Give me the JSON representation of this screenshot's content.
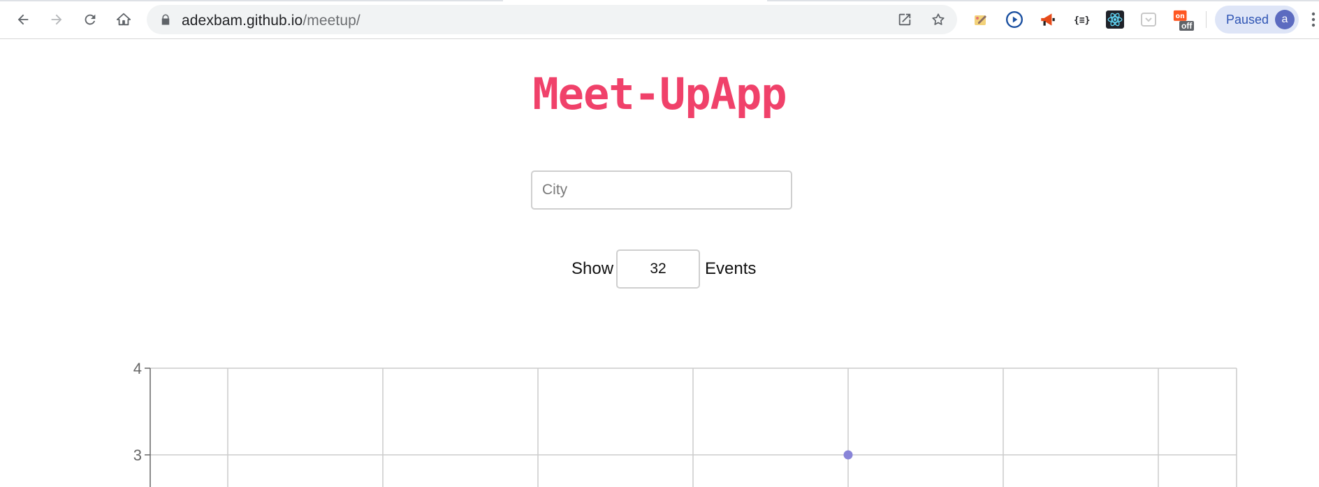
{
  "browser": {
    "url_host": "adexbam.github.io",
    "url_path": "/meetup/",
    "profile_status": "Paused",
    "profile_initial": "a",
    "extensions": [
      "color-picker-icon",
      "play-circle-icon",
      "megaphone-icon",
      "json-formatter-icon",
      "react-devtools-icon",
      "pocket-icon",
      "extension-off-icon"
    ],
    "extension_badge": "off"
  },
  "app": {
    "title": "Meet-UpApp",
    "city_placeholder": "City",
    "city_value": "",
    "show_label": "Show",
    "events_value": "32",
    "events_label": "Events"
  },
  "colors": {
    "title": "#f0416a",
    "point": "#8884d8",
    "grid": "#cccccc",
    "axis": "#666666"
  },
  "chart_data": {
    "type": "scatter",
    "y_ticks": [
      3,
      4
    ],
    "ylim": [
      2.6,
      4
    ],
    "x_gridlines": 7,
    "grid": true,
    "series": [
      {
        "points": [
          {
            "x": 5,
            "y": 3
          }
        ]
      }
    ],
    "xlim": [
      0,
      7.5
    ]
  }
}
